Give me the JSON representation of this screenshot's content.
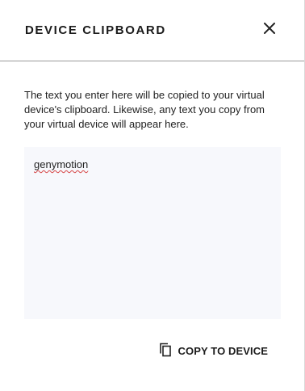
{
  "dialog": {
    "title": "DEVICE CLIPBOARD",
    "close_icon": "close-icon",
    "description": "The text you enter here will be copied to your virtual device's clipboard. Likewise, any text you copy from your virtual device will appear here.",
    "clipboard_value": "genymotion",
    "copy_button": {
      "icon": "copy-icon",
      "label": "COPY TO DEVICE"
    }
  },
  "colors": {
    "text": "#1b1b1b",
    "textarea_bg": "#f7f8fc",
    "divider": "#9a9a9a",
    "spellcheck": "#d64545"
  }
}
